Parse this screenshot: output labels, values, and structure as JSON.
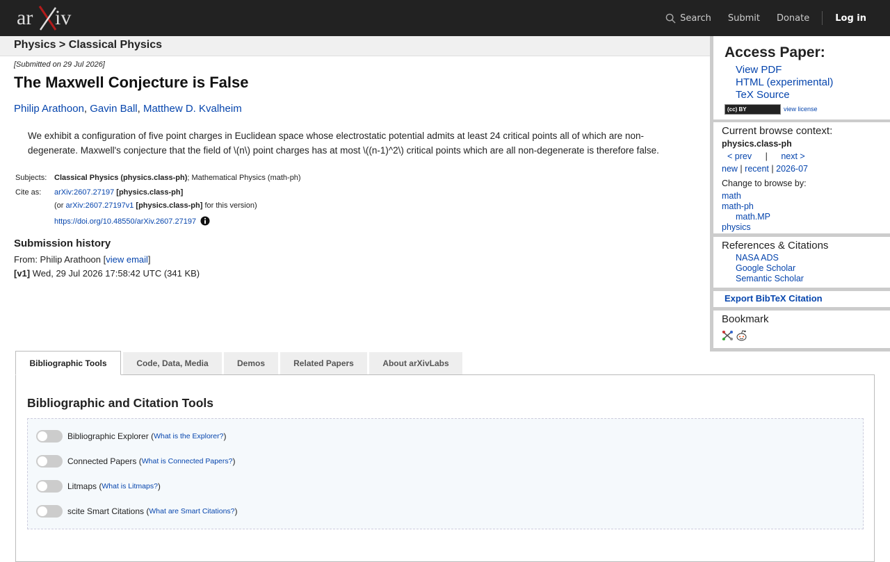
{
  "topbar": {
    "logo_alt": "arXiv",
    "search_label": "Search",
    "submit_label": "Submit",
    "donate_label": "Donate",
    "login_label": "Log in"
  },
  "breadcrumb": "Physics > Classical Physics",
  "paper": {
    "submitted": "[Submitted on 29 Jul 2026]",
    "title": "The Maxwell Conjecture is False",
    "authors": [
      "Philip Arathoon",
      "Gavin Ball",
      "Matthew D. Kvalheim"
    ],
    "author_sep": ", ",
    "abstract_line1": "We exhibit a configuration of five point charges in Euclidean space whose electrostatic potential admits at least 24 critical points all of which are non-",
    "abstract_line2": "degenerate. Maxwell's conjecture that the field of \\(n\\) point charges has at most \\((n-1)^2\\) critical points which are all non-degenerate is therefore false.",
    "subjects_label": "Subjects:",
    "subjects_primary": "Classical Physics (physics.class-ph)",
    "subjects_rest": "; Mathematical Physics (math-ph)",
    "cite_label": "Cite as:",
    "cite_id": "arXiv:2607.27197",
    "cite_cat": "[physics.class-ph]",
    "or_prefix": "(or ",
    "version_id": "arXiv:2607.27197v1",
    "version_cat": "[physics.class-ph]",
    "version_suffix": " for this version)",
    "doi": "https://doi.org/10.48550/arXiv.2607.27197"
  },
  "history": {
    "heading": "Submission history",
    "from_prefix": "From: Philip Arathoon [",
    "view_email": "view email",
    "from_suffix": "]",
    "v1_label": "[v1]",
    "v1_text": " Wed, 29 Jul 2026 17:58:42 UTC (341 KB)"
  },
  "sidebar": {
    "access_heading": "Access Paper:",
    "access_links": [
      "View PDF",
      "HTML (experimental)",
      "TeX Source"
    ],
    "cc_badge": "(cc) BY",
    "view_license": "view license",
    "context_heading": "Current browse context:",
    "context_category": "physics.class-ph",
    "prev": "< prev",
    "pipe": "|",
    "next": "next >",
    "new": "new",
    "recent": "recent",
    "month": "2026-07",
    "change_heading": "Change to browse by:",
    "browse_links": [
      "math",
      "math-ph",
      "math.MP",
      "physics"
    ],
    "refs_heading": "References & Citations",
    "refs_links": [
      "NASA ADS",
      "Google Scholar",
      "Semantic Scholar"
    ],
    "export_label": "Export BibTeX Citation",
    "bookmark_heading": "Bookmark"
  },
  "tabs": [
    {
      "label": "Bibliographic Tools",
      "active": true
    },
    {
      "label": "Code, Data, Media",
      "active": false
    },
    {
      "label": "Demos",
      "active": false
    },
    {
      "label": "Related Papers",
      "active": false
    },
    {
      "label": "About arXivLabs",
      "active": false
    }
  ],
  "tools": {
    "heading": "Bibliographic and Citation Tools",
    "items": [
      {
        "label": "Bibliographic Explorer",
        "help": "What is the Explorer?",
        "enabled": false
      },
      {
        "label": "Connected Papers",
        "help": "What is Connected Papers?",
        "enabled": false
      },
      {
        "label": "Litmaps",
        "help": "What is Litmaps?",
        "enabled": false
      },
      {
        "label": "scite Smart Citations",
        "help": "What are Smart Citations?",
        "enabled": false
      }
    ]
  },
  "colors": {
    "topbar": "#222222",
    "link": "#0645ad",
    "logo_x": "#b31b1b"
  }
}
